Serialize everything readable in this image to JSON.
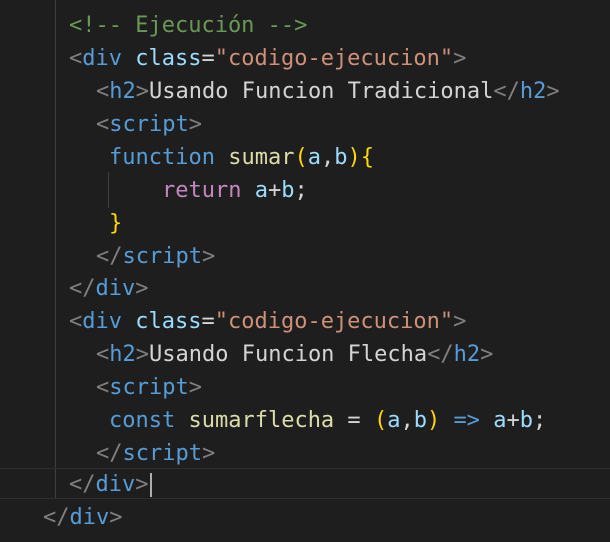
{
  "code": {
    "line1": {
      "comment": "<!-- Ejecución -->"
    },
    "line2": {
      "open": "<",
      "tag": "div",
      "attr": "class",
      "eq": "=",
      "value": "\"codigo-ejecucion\"",
      "close": ">"
    },
    "line3": {
      "open": "<",
      "tag": "h2",
      "close": ">",
      "text": "Usando Funcion Tradicional",
      "open_end": "</",
      "tag_end": "h2",
      "close_end": ">"
    },
    "line4": {
      "open": "<",
      "tag": "script",
      "close": ">"
    },
    "line5": {
      "keyword": "function",
      "name": "sumar",
      "lparen": "(",
      "p1": "a",
      "comma": ",",
      "p2": "b",
      "rparen": ")",
      "brace": "{"
    },
    "line6": {
      "keyword": "return",
      "expr_a": "a",
      "plus": "+",
      "expr_b": "b",
      "semi": ";"
    },
    "line7": {
      "brace": "}"
    },
    "line8": {
      "open": "</",
      "tag": "script",
      "close": ">"
    },
    "line9": {
      "open": "</",
      "tag": "div",
      "close": ">"
    },
    "line10": {
      "open": "<",
      "tag": "div",
      "attr": "class",
      "eq": "=",
      "value": "\"codigo-ejecucion\"",
      "close": ">"
    },
    "line11": {
      "open": "<",
      "tag": "h2",
      "close": ">",
      "text": "Usando Funcion Flecha",
      "open_end": "</",
      "tag_end": "h2",
      "close_end": ">"
    },
    "line12": {
      "open": "<",
      "tag": "script",
      "close": ">"
    },
    "line13": {
      "keyword": "const",
      "name": "sumarflecha",
      "assign": " = ",
      "lparen": "(",
      "p1": "a",
      "comma": ",",
      "p2": "b",
      "rparen": ")",
      "arrow": "=>",
      "expr_a": "a",
      "plus": "+",
      "expr_b": "b",
      "semi": ";"
    },
    "line14": {
      "open": "</",
      "tag": "script",
      "close": ">"
    },
    "line15": {
      "open": "</",
      "tag": "div",
      "close": ">"
    },
    "line16": {
      "open": "</",
      "tag": "div",
      "close": ">"
    }
  }
}
